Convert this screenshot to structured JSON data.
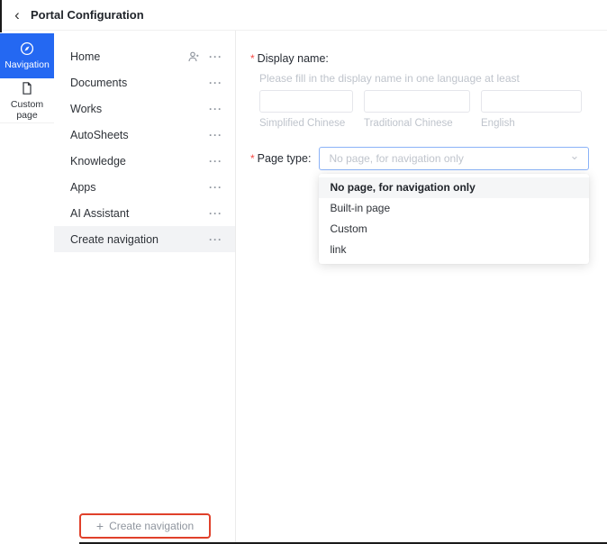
{
  "header": {
    "title": "Portal Configuration"
  },
  "icons": {
    "back": "‹",
    "more": "···",
    "plus": "+",
    "chevron_down": "⌄"
  },
  "rail": {
    "items": [
      {
        "label": "Navigation",
        "icon": "compass-icon",
        "active": true
      },
      {
        "label": "Custom page",
        "icon": "page-icon",
        "active": false
      }
    ]
  },
  "nav": {
    "items": [
      {
        "label": "Home"
      },
      {
        "label": "Documents"
      },
      {
        "label": "Works"
      },
      {
        "label": "AutoSheets"
      },
      {
        "label": "Knowledge"
      },
      {
        "label": "Apps"
      },
      {
        "label": "AI Assistant"
      },
      {
        "label": "Create navigation"
      }
    ],
    "create_button_label": "Create navigation"
  },
  "form": {
    "display_name": {
      "required_mark": "*",
      "label": "Display name:",
      "hint": "Please fill in the display name in one language at least",
      "fields": [
        {
          "caption": "Simplified Chinese",
          "value": ""
        },
        {
          "caption": "Traditional Chinese",
          "value": ""
        },
        {
          "caption": "English",
          "value": ""
        }
      ]
    },
    "page_type": {
      "required_mark": "*",
      "label": "Page type:",
      "value": "No page, for navigation only",
      "options": [
        {
          "label": "No page, for navigation only"
        },
        {
          "label": "Built-in page"
        },
        {
          "label": "Custom"
        },
        {
          "label": "link"
        }
      ]
    }
  },
  "colors": {
    "accent_blue": "#2468f2",
    "required_red": "#f54a45",
    "annotation_red": "#e0402a",
    "focus_border": "#8bb3f8"
  }
}
